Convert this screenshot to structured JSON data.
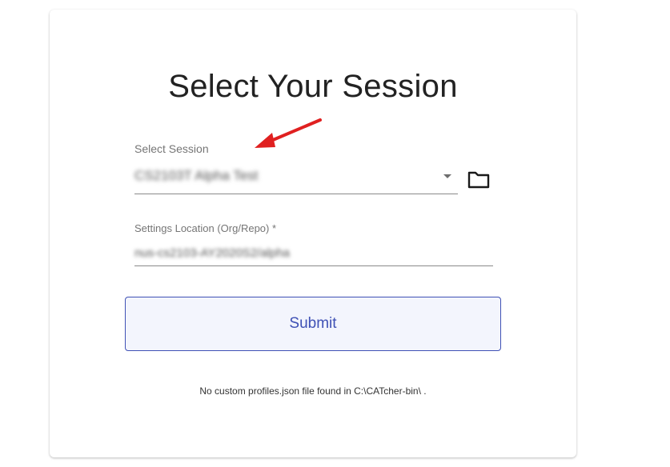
{
  "page": {
    "title": "Select Your Session"
  },
  "session_field": {
    "label": "Select Session",
    "value": "CS2103T Alpha Test"
  },
  "settings_field": {
    "label": "Settings Location (Org/Repo) *",
    "value": "nus-cs2103-AY2020S2/alpha"
  },
  "submit": {
    "label": "Submit"
  },
  "footer": {
    "note": "No custom profiles.json file found in C:\\CATcher-bin\\ ."
  },
  "icons": {
    "folder": "folder-icon",
    "dropdown": "chevron-down-icon",
    "annotation": "red-arrow-icon"
  },
  "colors": {
    "accent": "#3f51b5",
    "annotation": "#e02020"
  }
}
